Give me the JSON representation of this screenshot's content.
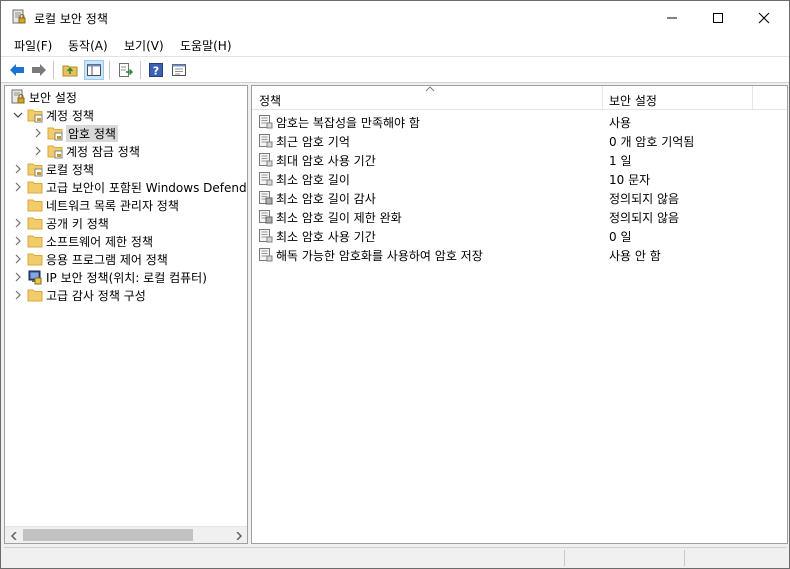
{
  "window": {
    "title": "로컬 보안 정책"
  },
  "menu": [
    {
      "label": "파일(F)"
    },
    {
      "label": "동작(A)"
    },
    {
      "label": "보기(V)"
    },
    {
      "label": "도움말(H)"
    }
  ],
  "toolbar": [
    {
      "icon": "back-arrow-icon"
    },
    {
      "icon": "forward-arrow-icon"
    },
    {
      "icon": "up-folder-icon"
    },
    {
      "icon": "show-hide-tree-icon"
    },
    {
      "icon": "export-list-icon"
    },
    {
      "icon": "help-icon"
    },
    {
      "icon": "properties-icon"
    }
  ],
  "tree": {
    "root": "보안 설정",
    "items": [
      {
        "label": "계정 정책",
        "level": 1,
        "expanded": true,
        "icon": "policy-folder-icon"
      },
      {
        "label": "암호 정책",
        "level": 2,
        "selected": true,
        "icon": "policy-folder-icon"
      },
      {
        "label": "계정 잠금 정책",
        "level": 2,
        "icon": "policy-folder-icon"
      },
      {
        "label": "로컬 정책",
        "level": 1,
        "icon": "policy-folder-icon"
      },
      {
        "label": "고급 보안이 포함된 Windows Defender",
        "level": 1,
        "icon": "folder-icon"
      },
      {
        "label": "네트워크 목록 관리자 정책",
        "level": 1,
        "icon": "folder-icon",
        "noExpander": true
      },
      {
        "label": "공개 키 정책",
        "level": 1,
        "icon": "folder-icon"
      },
      {
        "label": "소프트웨어 제한 정책",
        "level": 1,
        "icon": "folder-icon"
      },
      {
        "label": "응용 프로그램 제어 정책",
        "level": 1,
        "icon": "folder-icon"
      },
      {
        "label": "IP 보안 정책(위치: 로컬 컴퓨터)",
        "level": 1,
        "icon": "ip-security-icon"
      },
      {
        "label": "고급 감사 정책 구성",
        "level": 1,
        "icon": "folder-icon"
      }
    ]
  },
  "list": {
    "columns": {
      "policy": "정책",
      "setting": "보안 설정"
    },
    "rows": [
      {
        "policy": "암호는 복잡성을 만족해야 함",
        "setting": "사용",
        "icon": "policy-item-icon"
      },
      {
        "policy": "최근 암호 기억",
        "setting": "0 개 암호 기억됨",
        "icon": "policy-item-icon"
      },
      {
        "policy": "최대 암호 사용 기간",
        "setting": "1 일",
        "icon": "policy-item-icon"
      },
      {
        "policy": "최소 암호 길이",
        "setting": "10 문자",
        "icon": "policy-item-icon"
      },
      {
        "policy": "최소 암호 길이 감사",
        "setting": "정의되지 않음",
        "icon": "policy-item-undefined-icon"
      },
      {
        "policy": "최소 암호 길이 제한 완화",
        "setting": "정의되지 않음",
        "icon": "policy-item-undefined-icon"
      },
      {
        "policy": "최소 암호 사용 기간",
        "setting": "0 일",
        "icon": "policy-item-icon"
      },
      {
        "policy": "해독 가능한 암호화를 사용하여 암호 저장",
        "setting": "사용 안 함",
        "icon": "policy-item-icon"
      }
    ]
  },
  "colors": {
    "folder": "#f2cc6a",
    "folderDark": "#d9a93a",
    "selection": "#d9d9d9",
    "accent": "#1a74d2"
  }
}
